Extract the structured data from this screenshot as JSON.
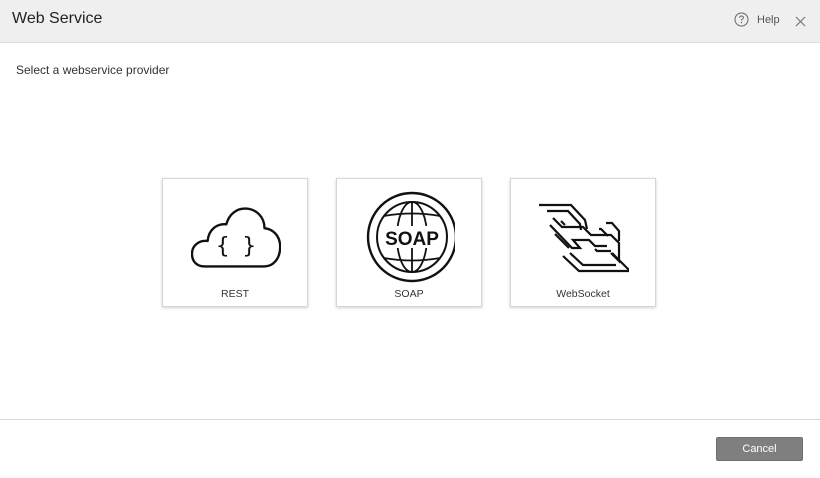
{
  "dialog": {
    "title": "Web Service",
    "help_label": "Help",
    "help_icon": "question-circle-icon",
    "close_icon": "close-icon"
  },
  "prompt": "Select a webservice provider",
  "providers": [
    {
      "label": "REST",
      "icon": "cloud-braces-icon"
    },
    {
      "label": "SOAP",
      "icon": "soap-globe-icon",
      "icon_text": "SOAP"
    },
    {
      "label": "WebSocket",
      "icon": "websocket-icon"
    }
  ],
  "footer": {
    "cancel_label": "Cancel"
  },
  "colors": {
    "header_bg": "#efefef",
    "cancel_bg": "#7f7f7f",
    "icon_stroke": "#111111"
  }
}
